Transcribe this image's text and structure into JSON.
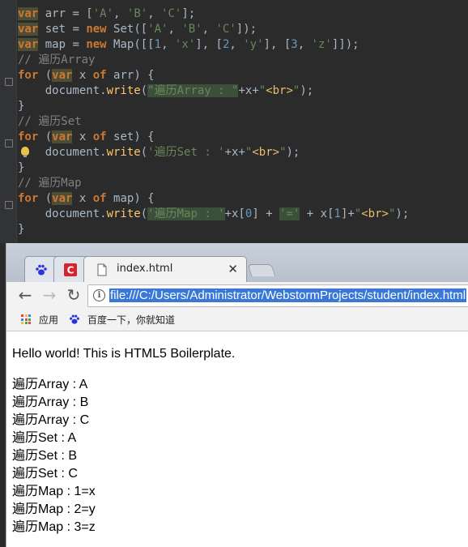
{
  "editor": {
    "lines": [
      [
        {
          "t": "var",
          "c": "kw hlvar"
        },
        {
          "t": " arr = ["
        },
        {
          "t": "'A'",
          "c": "str"
        },
        {
          "t": ", "
        },
        {
          "t": "'B'",
          "c": "str"
        },
        {
          "t": ", "
        },
        {
          "t": "'C'",
          "c": "str"
        },
        {
          "t": "];"
        }
      ],
      [
        {
          "t": "var",
          "c": "kw hlvar"
        },
        {
          "t": " set = "
        },
        {
          "t": "new",
          "c": "kw"
        },
        {
          "t": " Set(["
        },
        {
          "t": "'A'",
          "c": "str"
        },
        {
          "t": ", "
        },
        {
          "t": "'B'",
          "c": "str"
        },
        {
          "t": ", "
        },
        {
          "t": "'C'",
          "c": "str"
        },
        {
          "t": "]);"
        }
      ],
      [
        {
          "t": "var",
          "c": "kw hlvar"
        },
        {
          "t": " map = "
        },
        {
          "t": "new",
          "c": "kw"
        },
        {
          "t": " Map([["
        },
        {
          "t": "1",
          "c": "num"
        },
        {
          "t": ", "
        },
        {
          "t": "'x'",
          "c": "str"
        },
        {
          "t": "], ["
        },
        {
          "t": "2",
          "c": "num"
        },
        {
          "t": ", "
        },
        {
          "t": "'y'",
          "c": "str"
        },
        {
          "t": "], ["
        },
        {
          "t": "3",
          "c": "num"
        },
        {
          "t": ", "
        },
        {
          "t": "'z'",
          "c": "str"
        },
        {
          "t": "]]);"
        }
      ],
      [
        {
          "t": "// 遍历Array",
          "c": "cm"
        }
      ],
      [
        {
          "t": "for",
          "c": "kw"
        },
        {
          "t": " ("
        },
        {
          "t": "var",
          "c": "kw hlvar"
        },
        {
          "t": " x "
        },
        {
          "t": "of",
          "c": "kw"
        },
        {
          "t": " arr) {"
        }
      ],
      [
        {
          "t": "    document."
        },
        {
          "t": "write",
          "c": "fn"
        },
        {
          "t": "("
        },
        {
          "t": "\"遍历Array : \"",
          "c": "strh"
        },
        {
          "t": "+x+"
        },
        {
          "t": "\"",
          "c": "str"
        },
        {
          "t": "<br>",
          "c": "tag"
        },
        {
          "t": "\"",
          "c": "str"
        },
        {
          "t": ");"
        }
      ],
      [
        {
          "t": "}"
        }
      ],
      [
        {
          "t": "// 遍历Set",
          "c": "cm"
        }
      ],
      [
        {
          "t": "for",
          "c": "kw"
        },
        {
          "t": " ("
        },
        {
          "t": "var",
          "c": "kw hlvar"
        },
        {
          "t": " x "
        },
        {
          "t": "of",
          "c": "kw"
        },
        {
          "t": " set) {"
        }
      ],
      [
        {
          "t": "    document."
        },
        {
          "t": "write",
          "c": "fn"
        },
        {
          "t": "("
        },
        {
          "t": "'遍历Set : '",
          "c": "str"
        },
        {
          "t": "+x+"
        },
        {
          "t": "\"",
          "c": "str"
        },
        {
          "t": "<br>",
          "c": "tag"
        },
        {
          "t": "\"",
          "c": "str"
        },
        {
          "t": ");"
        }
      ],
      [
        {
          "t": "}"
        }
      ],
      [
        {
          "t": "// 遍历Map",
          "c": "cm"
        }
      ],
      [
        {
          "t": "for",
          "c": "kw"
        },
        {
          "t": " ("
        },
        {
          "t": "var",
          "c": "kw hlvar"
        },
        {
          "t": " x "
        },
        {
          "t": "of",
          "c": "kw"
        },
        {
          "t": " map) {"
        }
      ],
      [
        {
          "t": "    document."
        },
        {
          "t": "write",
          "c": "fn"
        },
        {
          "t": "("
        },
        {
          "t": "'遍历Map : '",
          "c": "strh"
        },
        {
          "t": "+x["
        },
        {
          "t": "0",
          "c": "num"
        },
        {
          "t": "] + "
        },
        {
          "t": "'='",
          "c": "strh"
        },
        {
          "t": " + x["
        },
        {
          "t": "1",
          "c": "num"
        },
        {
          "t": "]+"
        },
        {
          "t": "\"",
          "c": "str"
        },
        {
          "t": "<br>",
          "c": "tag"
        },
        {
          "t": "\"",
          "c": "str"
        },
        {
          "t": ");"
        }
      ],
      [
        {
          "t": "}"
        }
      ]
    ]
  },
  "browser": {
    "tab_title": "index.html",
    "tab_close": "✕",
    "url": "file:///C:/Users/Administrator/WebstormProjects/student/index.html",
    "bookmarks": {
      "apps_label": "应用",
      "baidu_label": "百度一下，你就知道"
    },
    "nav": {
      "back": "←",
      "forward": "→",
      "reload": "↻"
    },
    "content": {
      "heading": "Hello world! This is HTML5 Boilerplate.",
      "output": [
        "遍历Array : A",
        "遍历Array : B",
        "遍历Array : C",
        "遍历Set : A",
        "遍历Set : B",
        "遍历Set : C",
        "遍历Map : 1=x",
        "遍历Map : 2=y",
        "遍历Map : 3=z"
      ]
    },
    "colors": {
      "url_selection": "#3a78d8",
      "tab_active": "#f2f2f2",
      "chrome_frame": "#c9d1dc"
    }
  }
}
